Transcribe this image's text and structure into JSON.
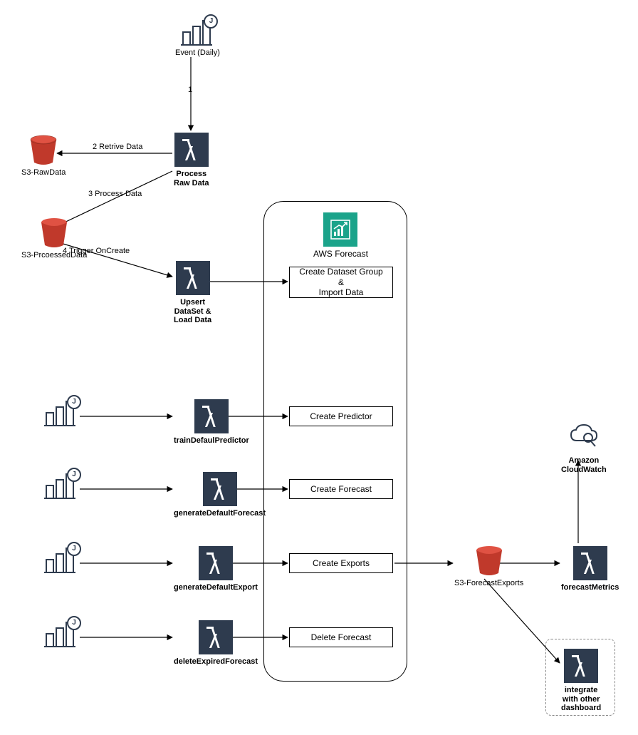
{
  "diagram": {
    "event_top": {
      "label": "Event (Daily)"
    },
    "lambda_process_raw": {
      "label": "Process\nRaw Data"
    },
    "lambda_upsert": {
      "label": "Upsert\nDataSet &\nLoad Data"
    },
    "lambda_train": {
      "label": "trainDefaulPredictor"
    },
    "lambda_genForecast": {
      "label": "generateDefaultForecast"
    },
    "lambda_genExport": {
      "label": "generateDefaultExport"
    },
    "lambda_deleteExpired": {
      "label": "deleteExpiredForecast"
    },
    "lambda_forecastMetrics": {
      "label": "forecastMetrics"
    },
    "lambda_integrate": {
      "label": "integrate\nwith other\ndashboard"
    },
    "s3_raw": {
      "label": "S3-RawData"
    },
    "s3_processed": {
      "label": "S3-PrcoessedData"
    },
    "s3_exports": {
      "label": "S3-ForecastExports"
    },
    "cloudwatch": {
      "label": "Amazon\nCloudWatch"
    },
    "forecast": {
      "title": "AWS Forecast",
      "create_dataset": "Create Dataset Group\n&\nImport Data",
      "create_predictor": "Create Predictor",
      "create_forecast": "Create Forecast",
      "create_exports": "Create Exports",
      "delete_forecast": "Delete Forecast"
    },
    "edges": {
      "e1": "1",
      "e2": "2 Retrive Data",
      "e3": "3 Process Data",
      "e4": "4 Trigger OnCreate"
    }
  }
}
